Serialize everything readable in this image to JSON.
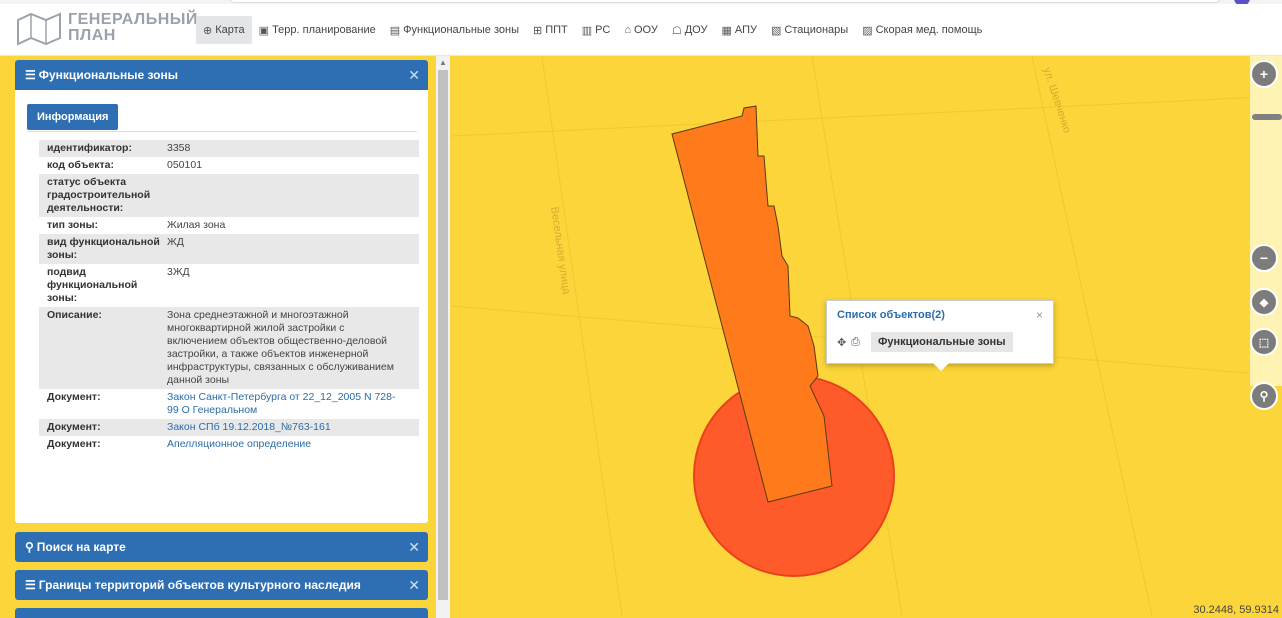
{
  "header": {
    "logo_text_line1": "ГЕНЕРАЛЬНЫЙ",
    "logo_text_line2": "ПЛАН",
    "nav": [
      {
        "label": "Карта",
        "icon": "globe-icon"
      },
      {
        "label": "Терр. планирование",
        "icon": "document-icon"
      },
      {
        "label": "Функциональные зоны",
        "icon": "table-icon"
      },
      {
        "label": "ППТ",
        "icon": "grid-icon"
      },
      {
        "label": "РС",
        "icon": "building-icon"
      },
      {
        "label": "ООУ",
        "icon": "school-icon"
      },
      {
        "label": "ДОУ",
        "icon": "child-icon"
      },
      {
        "label": "АПУ",
        "icon": "image-icon"
      },
      {
        "label": "Стационары",
        "icon": "hospital-icon"
      },
      {
        "label": "Скорая мед. помощь",
        "icon": "ambulance-icon"
      }
    ]
  },
  "panel_main": {
    "title": "Функциональные зоны",
    "tab": "Информация",
    "props": [
      {
        "k": "идентификатор:",
        "v": "3358"
      },
      {
        "k": "код объекта:",
        "v": "050101"
      },
      {
        "k": "статус объекта градостроительной деятельности:",
        "v": ""
      },
      {
        "k": "тип зоны:",
        "v": "Жилая зона"
      },
      {
        "k": "вид функциональной зоны:",
        "v": "ЖД"
      },
      {
        "k": "подвид функциональной зоны:",
        "v": "3ЖД"
      },
      {
        "k": "Описание:",
        "v": "Зона среднеэтажной и многоэтажной многоквартирной жилой застройки с включением объектов общественно-деловой застройки, а также объектов инженерной инфраструктуры, связанных с обслуживанием данной зоны"
      },
      {
        "k": "Документ:",
        "v": "Закон Санкт-Петербурга от 22_12_2005 N 728-99 О Генеральном",
        "link": true
      },
      {
        "k": "Документ:",
        "v": "Закон СПб 19.12.2018_№763-161",
        "link": true
      },
      {
        "k": "Документ:",
        "v": "Апелляционное определение",
        "link": true
      }
    ]
  },
  "panel_search": {
    "title": "Поиск на карте"
  },
  "panel_heritage": {
    "title": "Границы территорий объектов культурного наследия"
  },
  "popup": {
    "title": "Список объектов(2)",
    "item": "Функциональные зоны"
  },
  "map": {
    "labels": [
      "Весельная улица",
      "ул. Шевченко"
    ],
    "coords": "30.2448, 59.9314",
    "colors": {
      "background": "#fbd53a",
      "zone": "#ff7a1a",
      "circle": "#ff5a2a"
    }
  }
}
